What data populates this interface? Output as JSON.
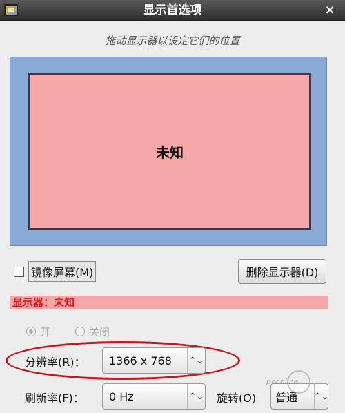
{
  "window": {
    "title": "显示首选项",
    "close_glyph": "×"
  },
  "hint": "拖动显示器以设定它们的位置",
  "monitor": {
    "label": "未知"
  },
  "mirror": {
    "label": "镜像屏幕(M)",
    "checked": false
  },
  "delete_button": {
    "label": "删除显示器(D)"
  },
  "display_header": "显示器：未知",
  "power": {
    "on_label": "开",
    "off_label": "关闭",
    "selected": "on"
  },
  "resolution": {
    "label": "分辨率(R)：",
    "value": "1366 x 768"
  },
  "refresh": {
    "label": "刷新率(F)：",
    "value": "0 Hz"
  },
  "rotation": {
    "label": "旋转(O)",
    "value": "普通"
  },
  "arrows_glyph": "⌃⌄",
  "watermark_text": "pconline",
  "colors": {
    "monitor_fill": "#f6a7a8",
    "canvas_fill": "#8aaad6",
    "header_text": "#d41a1a",
    "highlight_ring": "#c8161d"
  }
}
